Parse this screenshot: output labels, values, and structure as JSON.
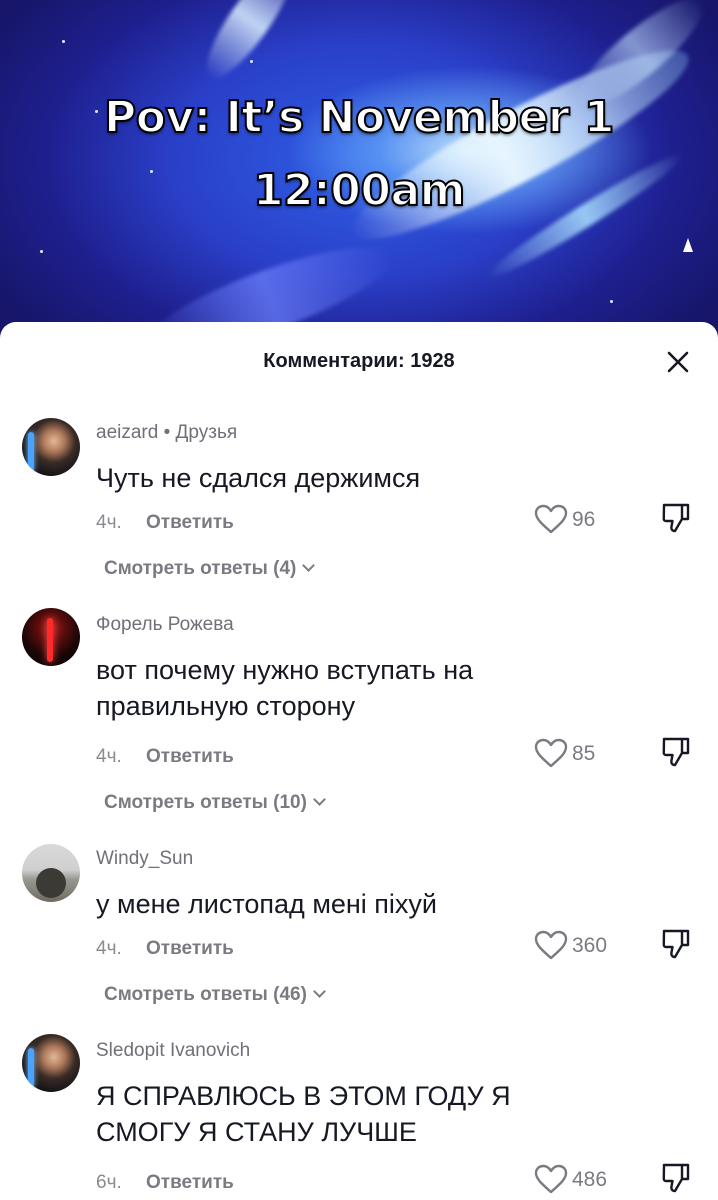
{
  "video": {
    "caption_line1": "Pov: It’s November 1",
    "caption_line2": "12:00am"
  },
  "comments_panel": {
    "title": "Комментарии: 1928",
    "close_icon": "close-icon"
  },
  "comments": [
    {
      "username": "aeizard • Друзья",
      "text_lines": [
        "Чуть не сдался держимся"
      ],
      "time": "4ч.",
      "reply_label": "Ответить",
      "likes": "96",
      "view_replies": "Смотреть ответы (4)"
    },
    {
      "username": "Форель Рожева",
      "text_lines": [
        "вот почему нужно вступать на",
        "правильную сторону"
      ],
      "time": "4ч.",
      "reply_label": "Ответить",
      "likes": "85",
      "view_replies": "Смотреть ответы (10)"
    },
    {
      "username": "Windy_Sun",
      "text_lines": [
        "у мене листопад мені піхуй"
      ],
      "time": "4ч.",
      "reply_label": "Ответить",
      "likes": "360",
      "view_replies": "Смотреть ответы (46)"
    },
    {
      "username": "Sledopit Ivanovich",
      "text_lines": [
        "Я СПРАВЛЮСЬ В ЭТОМ ГОДУ Я",
        "СМОГУ Я СТАНУ ЛУЧШЕ"
      ],
      "time": "6ч.",
      "reply_label": "Ответить",
      "likes": "486"
    }
  ],
  "icons": {
    "like": "heart-icon",
    "dislike": "thumbs-down-icon",
    "expand": "chevron-down-icon"
  }
}
